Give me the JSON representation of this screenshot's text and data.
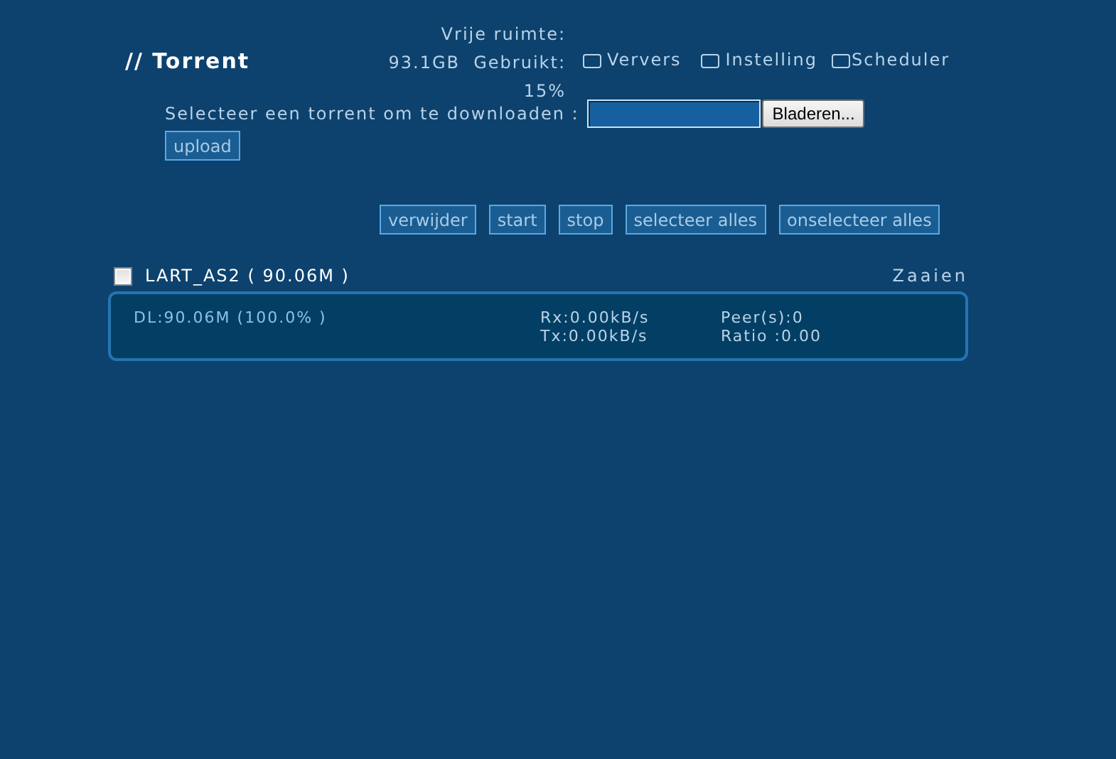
{
  "title": "// Torrent",
  "disk_info": [
    "Vrije ruimte:",
    "93.1GB  Gebruikt:",
    "15%"
  ],
  "menu_links": [
    {
      "label": "Ververs"
    },
    {
      "label": "Instelling"
    },
    {
      "label": "Scheduler"
    }
  ],
  "upload_form": {
    "label": "Selecteer een torrent om te downloaden :",
    "browse_button": "Bladeren...",
    "upload_button": "upload"
  },
  "actions": [
    "verwijder",
    "start",
    "stop",
    "selecteer alles",
    "onselecteer alles"
  ],
  "torrents": [
    {
      "name": "LART_AS2 ( 90.06M )",
      "checked": false,
      "status": "Zaaien",
      "dl": "DL:90.06M (100.0% )",
      "rx": "Rx:0.00kB/s",
      "tx": "Tx:0.00kB/s",
      "peers": "Peer(s):0",
      "ratio": "Ratio  :0.00"
    }
  ]
}
